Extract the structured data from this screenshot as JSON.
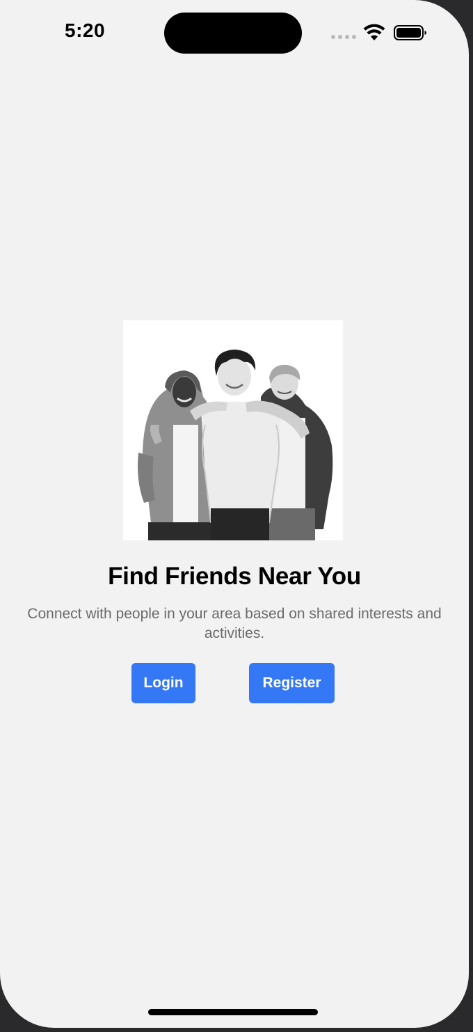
{
  "status_bar": {
    "time": "5:20",
    "icons": [
      "cellular-signal-icon",
      "wifi-icon",
      "battery-icon"
    ]
  },
  "hero": {
    "image_description_icon": "friends-illustration"
  },
  "main": {
    "title": "Find Friends Near You",
    "subtitle": "Connect with people in your area based on shared interests and activities.",
    "login_label": "Login",
    "register_label": "Register"
  },
  "colors": {
    "accent": "#3478f6",
    "background": "#f2f2f2",
    "subtitle_text": "#6b6b6b"
  }
}
